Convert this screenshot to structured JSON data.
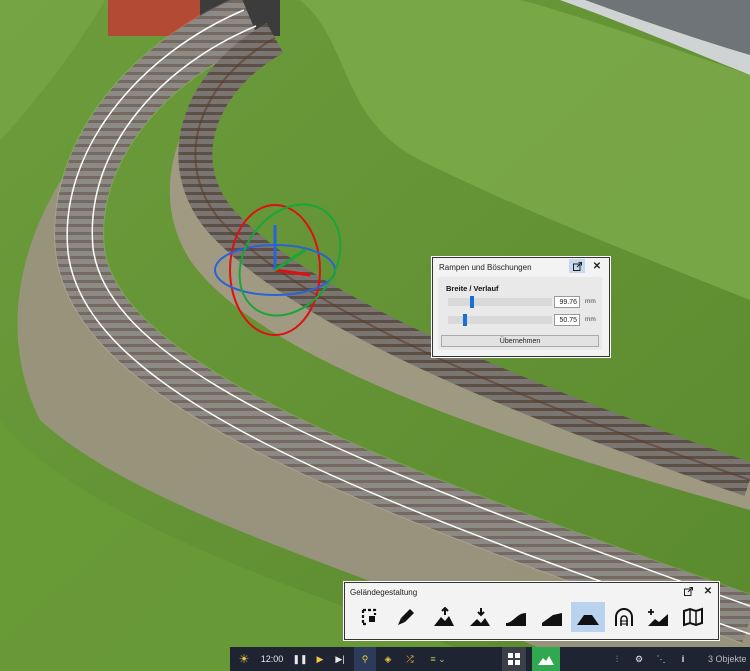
{
  "ramp_panel": {
    "title": "Rampen und Böschungen",
    "section_label": "Breite / Verlauf",
    "width_value": "99.76",
    "slope_value": "50.75",
    "unit": "mm",
    "width_level": 0.22,
    "slope_level": 0.15,
    "apply_label": "Übernehmen"
  },
  "terrain_panel": {
    "title": "Geländegestaltung",
    "tools": [
      "select-area-icon",
      "paint-brush-icon",
      "raise-terrain-icon",
      "lower-terrain-icon",
      "ramp-icon",
      "ramp-steep-icon",
      "embankment-icon",
      "tunnel-icon",
      "add-terrain-icon",
      "texture-map-icon"
    ],
    "active_tool": "embankment-icon"
  },
  "taskbar": {
    "time": "12:00",
    "objects": "3 Objekte"
  },
  "colors": {
    "accent": "#1a6fd6",
    "active_tool_bg": "#b9d3ee",
    "taskbar_bg": "#1f2433",
    "terrain_green": "#2fa84f"
  }
}
